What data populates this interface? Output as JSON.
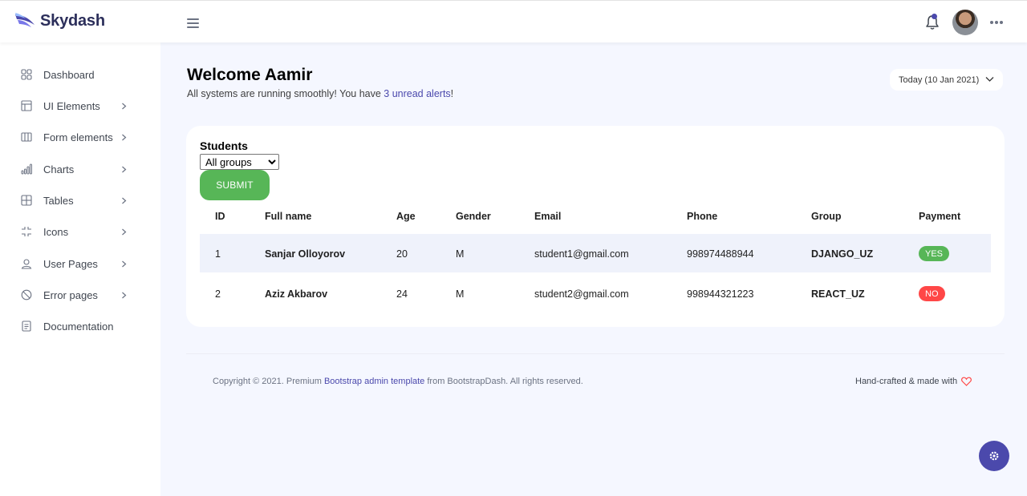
{
  "brand": {
    "name": "Skydash"
  },
  "sidebar": {
    "items": [
      {
        "label": "Dashboard"
      },
      {
        "label": "UI Elements"
      },
      {
        "label": "Form elements"
      },
      {
        "label": "Charts"
      },
      {
        "label": "Tables"
      },
      {
        "label": "Icons"
      },
      {
        "label": "User Pages"
      },
      {
        "label": "Error pages"
      },
      {
        "label": "Documentation"
      }
    ]
  },
  "header": {
    "welcome_title": "Welcome Aamir",
    "welcome_text_before": "All systems are running smoothly! You have ",
    "welcome_link": "3 unread alerts",
    "welcome_text_after": "!",
    "date_label": "Today (10 Jan 2021)"
  },
  "students": {
    "title": "Students",
    "select_value": "All groups",
    "submit_label": "SUBMIT",
    "columns": [
      "ID",
      "Full name",
      "Age",
      "Gender",
      "Email",
      "Phone",
      "Group",
      "Payment"
    ],
    "rows": [
      {
        "id": "1",
        "name": "Sanjar Olloyorov",
        "age": "20",
        "gender": "M",
        "email": "student1@gmail.com",
        "phone": "998974488944",
        "group": "DJANGO_UZ",
        "payment": "YES"
      },
      {
        "id": "2",
        "name": "Aziz Akbarov",
        "age": "24",
        "gender": "M",
        "email": "student2@gmail.com",
        "phone": "998944321223",
        "group": "REACT_UZ",
        "payment": "NO"
      }
    ]
  },
  "footer": {
    "copyright_before": "Copyright © 2021. Premium ",
    "copyright_link": "Bootstrap admin template",
    "copyright_after": " from BootstrapDash. All rights reserved.",
    "handcrafted": "Hand-crafted & made with"
  },
  "colors": {
    "accent": "#4b49ac",
    "success": "#57b657",
    "danger": "#ff4747",
    "background": "#f5f7ff"
  },
  "icons": {
    "bell": "bell-icon",
    "more": "more-horizontal-icon",
    "menu": "hamburger-icon",
    "settings": "gear-icon",
    "heart": "heart-icon"
  }
}
